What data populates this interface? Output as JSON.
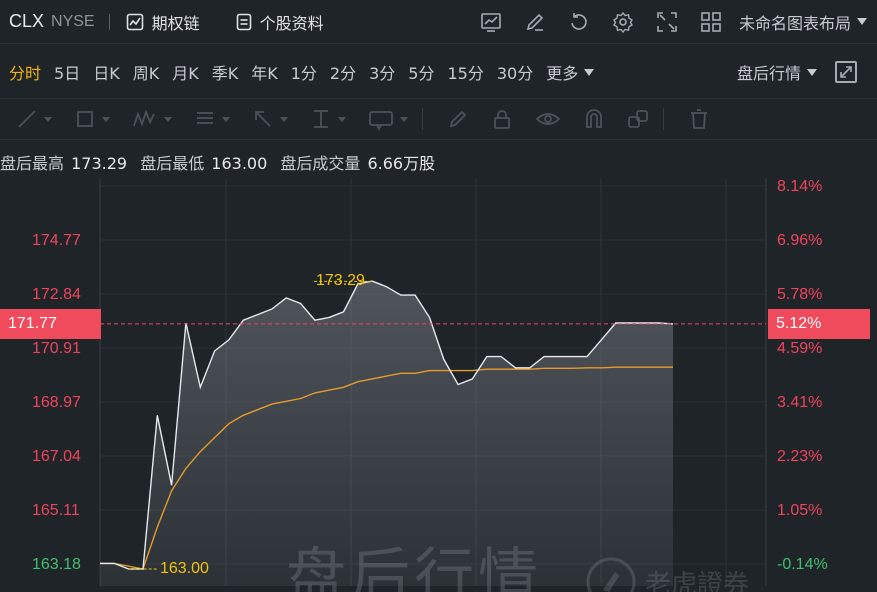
{
  "header": {
    "symbol": "CLX",
    "exchange": "NYSE",
    "links": [
      "期权链",
      "个股资料"
    ],
    "layout_label": "未命名图表布局"
  },
  "tools": [
    "chart-icon",
    "edit-icon",
    "undo-icon",
    "gear-icon",
    "fullscreen-expand-icon",
    "grid-layout-icon"
  ],
  "periods": [
    "分时",
    "5日",
    "日K",
    "周K",
    "月K",
    "季K",
    "年K",
    "1分",
    "2分",
    "3分",
    "5分",
    "15分",
    "30分"
  ],
  "active_period": "分时",
  "more_label": "更多",
  "session_selector": "盘后行情",
  "drawing_tools": [
    "line-tool-icon",
    "rect-tool-icon",
    "pattern-tool-icon",
    "fib-tool-icon",
    "arrow-tool-icon",
    "measure-tool-icon",
    "label-tool-icon",
    "pencil-icon",
    "lock-icon",
    "eye-icon",
    "magnet-icon",
    "group-icon",
    "trash-icon"
  ],
  "after_hours": {
    "high_label": "盘后最高",
    "high_value": "173.29",
    "low_label": "盘后最低",
    "low_value": "163.00",
    "volume_label": "盘后成交量",
    "volume_value": "6.66万股"
  },
  "colors": {
    "up": "#f0435b",
    "down": "#3fc06c",
    "avg_line": "#e69a2a",
    "price_line": "#e6e8eb",
    "marker": "#f2c30a"
  },
  "chart_data": {
    "type": "area",
    "y_labels_left": [
      "174.77",
      "172.84",
      "170.91",
      "168.97",
      "167.04",
      "165.11",
      "163.18"
    ],
    "y_labels_right": [
      "8.14%",
      "6.96%",
      "5.78%",
      "4.59%",
      "3.41%",
      "2.23%",
      "1.05%",
      "-0.14%"
    ],
    "current_price": "171.77",
    "current_change": "5.12%",
    "high_marker": "173.29",
    "low_marker": "163.00",
    "watermark": "盘后行情",
    "brand": "老虎證券",
    "price": [
      163.2,
      163.2,
      163.0,
      163.0,
      168.5,
      166.0,
      171.8,
      169.5,
      170.8,
      171.2,
      171.9,
      172.1,
      172.3,
      172.7,
      172.5,
      171.9,
      172.0,
      172.2,
      173.2,
      173.3,
      173.1,
      172.8,
      172.8,
      172.0,
      170.5,
      169.6,
      169.8,
      170.6,
      170.6,
      170.2,
      170.2,
      170.6,
      170.6,
      170.6,
      170.6,
      171.2,
      171.8,
      171.8,
      171.8,
      171.8,
      171.77
    ],
    "avg": [
      163.2,
      163.2,
      163.1,
      163.0,
      164.5,
      165.8,
      166.6,
      167.2,
      167.7,
      168.2,
      168.5,
      168.7,
      168.9,
      169.0,
      169.1,
      169.3,
      169.4,
      169.5,
      169.7,
      169.8,
      169.9,
      170.0,
      170.0,
      170.1,
      170.1,
      170.1,
      170.1,
      170.15,
      170.15,
      170.15,
      170.15,
      170.18,
      170.18,
      170.18,
      170.2,
      170.2,
      170.22,
      170.22,
      170.22,
      170.22,
      170.22
    ]
  }
}
